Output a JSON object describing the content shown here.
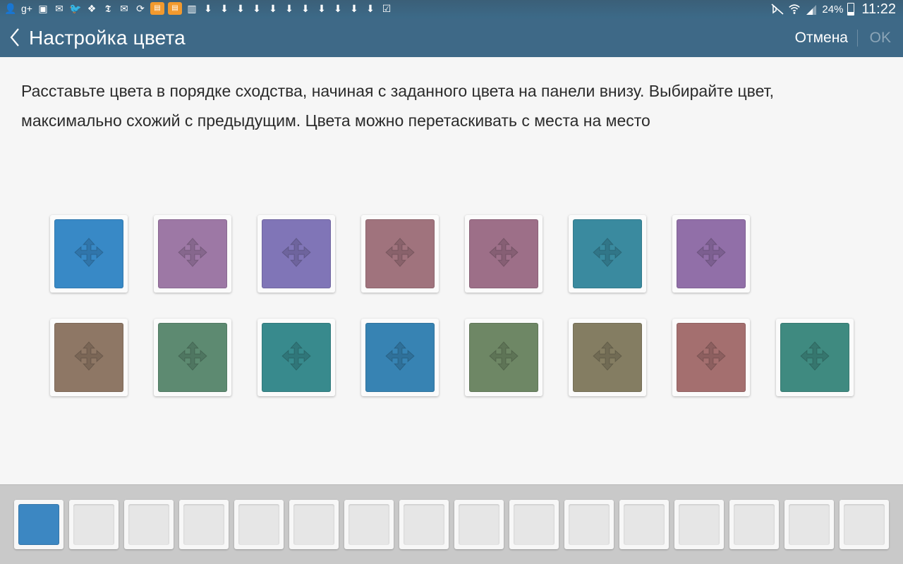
{
  "status_bar": {
    "left_icons": [
      "contacts-icon",
      "google-plus-icon",
      "image-icon",
      "email-icon",
      "twitter-icon",
      "dropbox-icon",
      "nytimes-icon",
      "gmail-icon",
      "sync-icon",
      "app-tile-icon",
      "app-tile-icon",
      "sim-card-icon",
      "download-icon",
      "download-icon",
      "download-icon",
      "download-icon",
      "download-icon",
      "download-icon",
      "download-icon",
      "download-icon",
      "download-icon",
      "download-icon",
      "download-icon",
      "calendar-check-icon"
    ],
    "battery_percent": "24%",
    "time": "11:22"
  },
  "action_bar": {
    "title": "Настройка цвета",
    "cancel_label": "Отмена",
    "ok_label": "OK"
  },
  "instruction": "Расставьте цвета в порядке сходства, начиная с заданного цвета на панели внизу. Выбирайте цвет, максимально схожий с предыдущим. Цвета можно перетаскивать с места на место",
  "tiles": {
    "row1": [
      "#3889c6",
      "#9d78a5",
      "#8075b7",
      "#a0737d",
      "#9d6f88",
      "#3a8a9f",
      "#916fa8"
    ],
    "row2": [
      "#8e7765",
      "#5d8a71",
      "#388a8d",
      "#3783b3",
      "#6e8765",
      "#847d62",
      "#a46f6f",
      "#3f8a80"
    ]
  },
  "answer_panel": {
    "slot_count": 16,
    "filled": [
      {
        "slot": 0,
        "color": "#3c87c2"
      }
    ],
    "empty_color": "#e6e6e6"
  }
}
